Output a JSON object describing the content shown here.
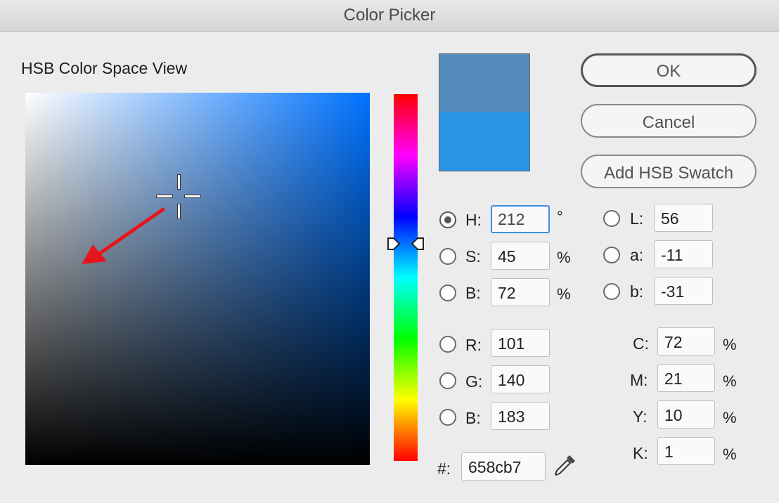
{
  "window": {
    "title": "Color Picker"
  },
  "color_space": {
    "title": "HSB Color Space View"
  },
  "buttons": {
    "ok": "OK",
    "cancel": "Cancel",
    "add_swatch": "Add HSB Swatch"
  },
  "preview": {
    "new_color": "#548dbd",
    "current_color": "#2a94e5"
  },
  "hsb": {
    "h": {
      "label": "H:",
      "value": "212",
      "unit": "°"
    },
    "s": {
      "label": "S:",
      "value": "45",
      "unit": "%"
    },
    "b": {
      "label": "B:",
      "value": "72",
      "unit": "%"
    }
  },
  "rgb": {
    "r": {
      "label": "R:",
      "value": "101"
    },
    "g": {
      "label": "G:",
      "value": "140"
    },
    "b": {
      "label": "B:",
      "value": "183"
    }
  },
  "lab": {
    "l": {
      "label": "L:",
      "value": "56"
    },
    "a": {
      "label": "a:",
      "value": "-11"
    },
    "b": {
      "label": "b:",
      "value": "-31"
    }
  },
  "cmyk": {
    "c": {
      "label": "C:",
      "value": "72",
      "unit": "%"
    },
    "m": {
      "label": "M:",
      "value": "21",
      "unit": "%"
    },
    "y": {
      "label": "Y:",
      "value": "10",
      "unit": "%"
    },
    "k": {
      "label": "K:",
      "value": "1",
      "unit": "%"
    }
  },
  "hex": {
    "label": "#:",
    "value": "658cb7"
  },
  "selected_mode": "H",
  "icons": {
    "eyedropper": "eyedropper-icon",
    "arrow": "red-arrow-annotation"
  },
  "accent_colors": {
    "focus": "#3b8fe0",
    "annotation": "#e8141b"
  }
}
